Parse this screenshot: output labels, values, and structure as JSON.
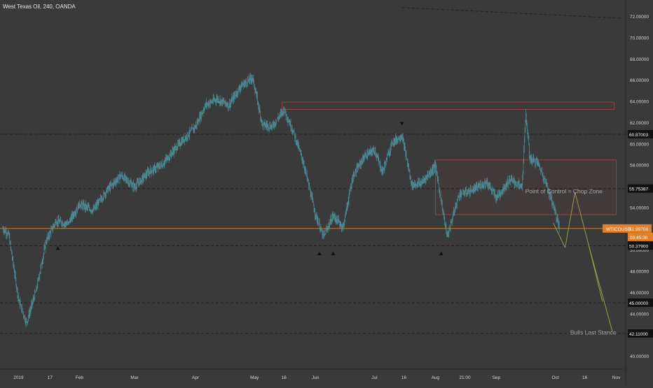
{
  "header": {
    "title": "West Texas Oil, 240, OANDA"
  },
  "colors": {
    "background": "#3a3a3a",
    "candle": "#4e8f9a",
    "axis_text": "#d6d6d6",
    "gridline": "#2a2a2a",
    "level_line": "#1e1e1e",
    "current_price": "#e0802a",
    "resistance_zone": "#b04a4a",
    "projection": "#9a9c4a",
    "annotation_text": "#a8a8a8",
    "pivot_marker": "#0f0f0f"
  },
  "chart_data": {
    "type": "line",
    "title": "West Texas Oil, 240, OANDA",
    "symbol": "WTICOUSD",
    "timeframe": "240",
    "source": "OANDA",
    "xlabel": "",
    "ylabel": "",
    "ylim": [
      39.0,
      73.0
    ],
    "x_ticks": [
      "2019",
      "17",
      "Feb",
      "Mar",
      "Apr",
      "May",
      "16",
      "Jun",
      "Jul",
      "16",
      "Aug",
      "21:00",
      "Sep",
      "Oct",
      "16",
      "Nov"
    ],
    "x_tick_dates": [
      "2019-01-01",
      "2019-01-17",
      "2019-02-01",
      "2019-03-01",
      "2019-04-01",
      "2019-05-01",
      "2019-05-16",
      "2019-06-01",
      "2019-07-01",
      "2019-07-16",
      "2019-08-01",
      "2019-08-16",
      "2019-09-01",
      "2019-10-01",
      "2019-10-16",
      "2019-11-01"
    ],
    "y_ticks": [
      40,
      42,
      44,
      46,
      48,
      50,
      52,
      54,
      56,
      58,
      60,
      62,
      64,
      66,
      68,
      70,
      72
    ],
    "y_tick_labels": [
      "40.00000",
      "42.00000",
      "44.00000",
      "46.00000",
      "48.00000",
      "50.00000",
      "52.00000",
      "54.00000",
      "56.00000",
      "58.00000",
      "60.00000",
      "62.00000",
      "64.00000",
      "66.00000",
      "68.00000",
      "70.00000",
      "72.00000"
    ],
    "price_series": {
      "x": [
        "2018-12-24",
        "2018-12-27",
        "2019-01-01",
        "2019-01-05",
        "2019-01-10",
        "2019-01-15",
        "2019-01-20",
        "2019-01-26",
        "2019-02-01",
        "2019-02-08",
        "2019-02-15",
        "2019-02-22",
        "2019-03-01",
        "2019-03-08",
        "2019-03-15",
        "2019-03-22",
        "2019-04-01",
        "2019-04-06",
        "2019-04-12",
        "2019-04-18",
        "2019-04-24",
        "2019-04-30",
        "2019-05-05",
        "2019-05-10",
        "2019-05-16",
        "2019-05-21",
        "2019-05-26",
        "2019-06-01",
        "2019-06-05",
        "2019-06-10",
        "2019-06-15",
        "2019-06-20",
        "2019-06-26",
        "2019-07-01",
        "2019-07-05",
        "2019-07-10",
        "2019-07-15",
        "2019-07-20",
        "2019-07-25",
        "2019-08-01",
        "2019-08-04",
        "2019-08-07",
        "2019-08-13",
        "2019-08-20",
        "2019-08-27",
        "2019-09-01",
        "2019-09-08",
        "2019-09-14",
        "2019-09-16",
        "2019-09-18",
        "2019-09-22",
        "2019-09-26",
        "2019-10-01",
        "2019-10-03"
      ],
      "y": [
        52.0,
        51.4,
        45.3,
        43.1,
        46.2,
        50.8,
        52.7,
        52.4,
        54.3,
        53.7,
        55.6,
        57.0,
        55.9,
        57.3,
        58.0,
        59.6,
        61.6,
        63.6,
        64.2,
        63.6,
        65.4,
        66.2,
        61.8,
        61.6,
        63.2,
        61.0,
        58.1,
        53.3,
        51.2,
        53.2,
        52.1,
        56.9,
        58.8,
        59.4,
        57.3,
        60.1,
        60.7,
        56.1,
        56.3,
        57.9,
        54.5,
        51.2,
        55.2,
        55.6,
        56.4,
        54.9,
        56.6,
        55.9,
        62.8,
        58.6,
        58.2,
        56.4,
        53.6,
        52.0
      ]
    },
    "horizontal_levels": [
      {
        "price": 60.87003,
        "label": "60.87003"
      },
      {
        "price": 55.75387,
        "label": "55.75387"
      },
      {
        "price": 50.379,
        "label": "50.37900"
      },
      {
        "price": 45.0,
        "label": "45.00000"
      },
      {
        "price": 42.11,
        "label": "42.11000"
      }
    ],
    "current_price": {
      "symbol": "WTICOUSD",
      "price": 51.997,
      "label": "51.99700",
      "countdown": "03:45:38"
    },
    "zones": [
      {
        "x": [
          "2019-05-15",
          "2019-10-31"
        ],
        "y": [
          63.2,
          63.9
        ],
        "color": "#b04a4a"
      },
      {
        "x": [
          "2019-08-01",
          "2019-11-01"
        ],
        "y": [
          53.3,
          58.45
        ],
        "color": "#b04a4a"
      }
    ],
    "trendline": {
      "x": [
        "2019-07-15",
        "2019-11-04"
      ],
      "y": [
        72.8,
        71.8
      ]
    },
    "projection_path": {
      "x": [
        "2019-09-30",
        "2019-10-06",
        "2019-10-11",
        "2019-10-18",
        "2019-10-25"
      ],
      "y": [
        52.5,
        50.2,
        55.4,
        50.4,
        45.1
      ]
    },
    "projection_alt": {
      "x": [
        "2019-10-18",
        "2019-10-30"
      ],
      "y": [
        50.4,
        42.3
      ]
    },
    "pivot_markers": [
      {
        "x": "2019-01-21",
        "y": 50.5,
        "dir": "up"
      },
      {
        "x": "2019-06-03",
        "y": 50.0,
        "dir": "up"
      },
      {
        "x": "2019-06-10",
        "y": 50.0,
        "dir": "up"
      },
      {
        "x": "2019-07-15",
        "y": 61.5,
        "dir": "down"
      },
      {
        "x": "2019-08-04",
        "y": 50.0,
        "dir": "up"
      }
    ],
    "annotations": [
      {
        "text": "Point of Control = Chop Zone",
        "x": "2019-10-25",
        "y": 55.3
      },
      {
        "text": "Bulls Last Stance",
        "x": "2019-11-01",
        "y": 42.0
      }
    ]
  }
}
